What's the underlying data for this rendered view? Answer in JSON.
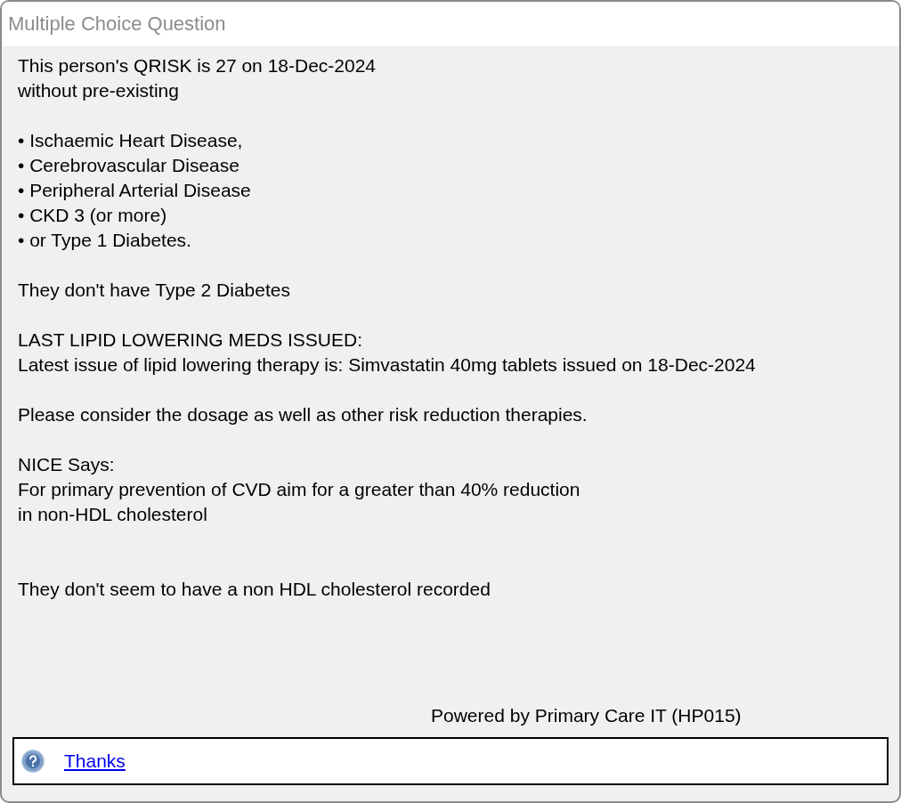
{
  "window": {
    "title": "Multiple Choice Question"
  },
  "message": {
    "blocks": [
      {
        "lines": [
          "This person's QRISK is 27 on 18-Dec-2024",
          "without pre-existing"
        ]
      },
      {
        "lines": [
          "• Ischaemic Heart Disease,",
          "• Cerebrovascular Disease",
          "• Peripheral Arterial Disease",
          "• CKD 3 (or more)",
          "• or Type 1 Diabetes."
        ]
      },
      {
        "lines": [
          "They don't have Type 2 Diabetes"
        ]
      },
      {
        "lines": [
          "LAST LIPID LOWERING MEDS ISSUED:",
          "Latest issue of lipid lowering therapy is: Simvastatin 40mg tablets issued on 18-Dec-2024"
        ]
      },
      {
        "lines": [
          "Please consider the dosage as well as other risk reduction therapies."
        ]
      },
      {
        "lines": [
          "NICE Says:",
          "For primary prevention of CVD aim for a greater than 40% reduction",
          "in non-HDL cholesterol"
        ]
      }
    ],
    "closing": "They don't seem to have a non HDL cholesterol recorded"
  },
  "footer_note": "Powered by Primary Care IT (HP015)",
  "options": [
    {
      "label": "Thanks"
    }
  ]
}
